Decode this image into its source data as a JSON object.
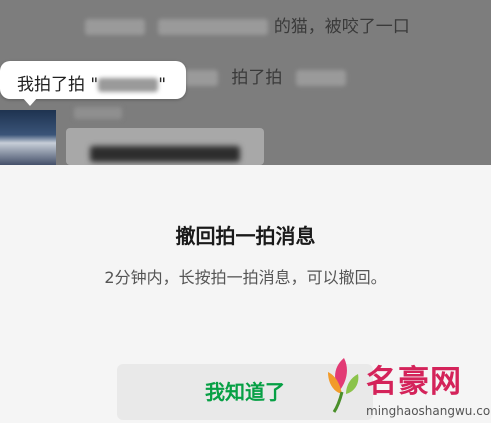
{
  "chat": {
    "message1_suffix": "的猫，被咬了一口",
    "message2_text": "拍了拍"
  },
  "tooltip": {
    "text": "我拍了拍 \"",
    "close_quote": "\""
  },
  "dialog": {
    "title": "撤回拍一拍消息",
    "description": "2分钟内，长按拍一拍消息，可以撤回。",
    "confirm_label": "我知道了"
  },
  "watermark": {
    "name": "名豪网",
    "url": "minghaoshangwu.com"
  },
  "colors": {
    "confirm_text": "#07a045",
    "watermark_red": "#d4235a"
  }
}
